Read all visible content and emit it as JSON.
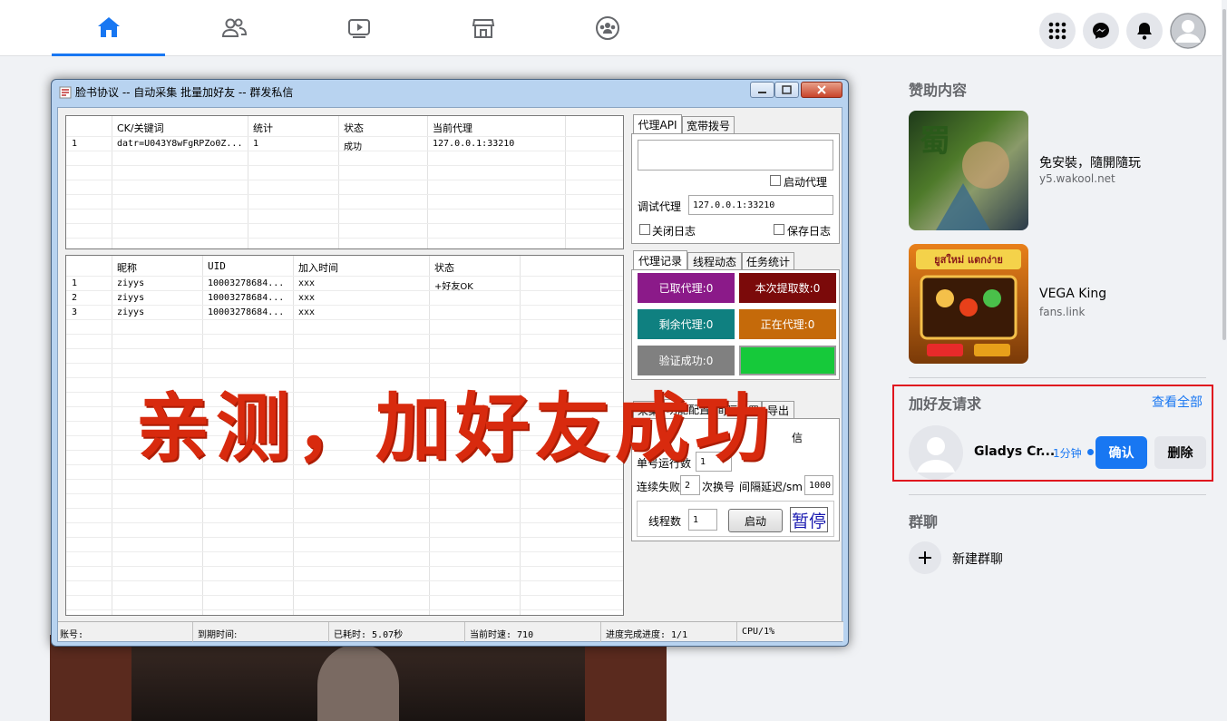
{
  "nav": {
    "tabs": [
      "home-icon",
      "friends-icon",
      "watch-icon",
      "marketplace-icon",
      "groups-icon"
    ],
    "right_icons": [
      "menu-grid-icon",
      "messenger-icon",
      "notifications-icon",
      "account-avatar"
    ],
    "accent": "#1877f2"
  },
  "sponsored": {
    "title": "赞助内容",
    "ads": [
      {
        "title": "免安裝，隨開隨玩",
        "domain": "y5.wakool.net"
      },
      {
        "title": "VEGA King",
        "domain": "fans.link",
        "image_text": "ยูสใหม่ แตกง่าย"
      }
    ]
  },
  "friend_requests": {
    "title": "加好友请求",
    "see_all": "查看全部",
    "name": "Gladys Cr...",
    "time": "1分钟",
    "confirm": "确认",
    "delete": "删除",
    "highlight_color": "#e0141e"
  },
  "group_chat": {
    "title": "群聊",
    "new_label": "新建群聊"
  },
  "tool": {
    "window_title": "脸书协议 -- 自动采集 批量加好友 -- 群发私信",
    "grid1": {
      "headers": [
        "",
        "CK/关键词",
        "统计",
        "状态",
        "当前代理"
      ],
      "rows": [
        [
          "1",
          "datr=U043Y8wFgRPZo0Z...",
          "1",
          "成功",
          "127.0.0.1:33210"
        ]
      ]
    },
    "grid2": {
      "headers": [
        "",
        "昵称",
        "UID",
        "加入时间",
        "状态"
      ],
      "rows": [
        [
          "1",
          "ziyys",
          "10003278684...",
          "xxx",
          "+好友OK"
        ],
        [
          "2",
          "ziyys",
          "10003278684...",
          "xxx",
          ""
        ],
        [
          "3",
          "ziyys",
          "10003278684...",
          "xxx",
          ""
        ]
      ]
    },
    "proxy_tabs": [
      "代理API",
      "宽带拨号"
    ],
    "enable_proxy": "启动代理",
    "debug_proxy_label": "调试代理",
    "debug_proxy_value": "127.0.0.1:33210",
    "close_log": "关闭日志",
    "save_log": "保存日志",
    "record_tabs": [
      "代理记录",
      "线程动态",
      "任务统计"
    ],
    "counters": [
      {
        "label": "已取代理:0",
        "color": "#8b1a89"
      },
      {
        "label": "本次提取数:0",
        "color": "#7b0a0a"
      },
      {
        "label": "剩余代理:0",
        "color": "#0f8080"
      },
      {
        "label": "正在代理:0",
        "color": "#c56a0a"
      },
      {
        "label": "验证成功:0",
        "color": "#808080"
      }
    ],
    "progress_color": "#16c93a",
    "config_tabs": [
      "采集",
      "功能配置",
      "间隔设置",
      "导出"
    ],
    "config_partial": "信",
    "per_account_label": "单号运行数",
    "per_account_value": "1",
    "fail_label": "连续失败",
    "fail_value": "2",
    "switch_label": "次换号",
    "interval_label": "间隔延迟/sm",
    "interval_value": "1000",
    "threads_label": "线程数",
    "threads_value": "1",
    "start_btn": "启动",
    "pause_btn": "暂停",
    "status": {
      "account": "账号:",
      "expire": "到期时间:",
      "elapsed": "已耗时: 5.07秒",
      "speed": "当前时速: 710",
      "progress": "进度完成进度: 1/1",
      "cpu": "CPU/1%"
    }
  },
  "overlay_text": "亲测，加好友成功"
}
